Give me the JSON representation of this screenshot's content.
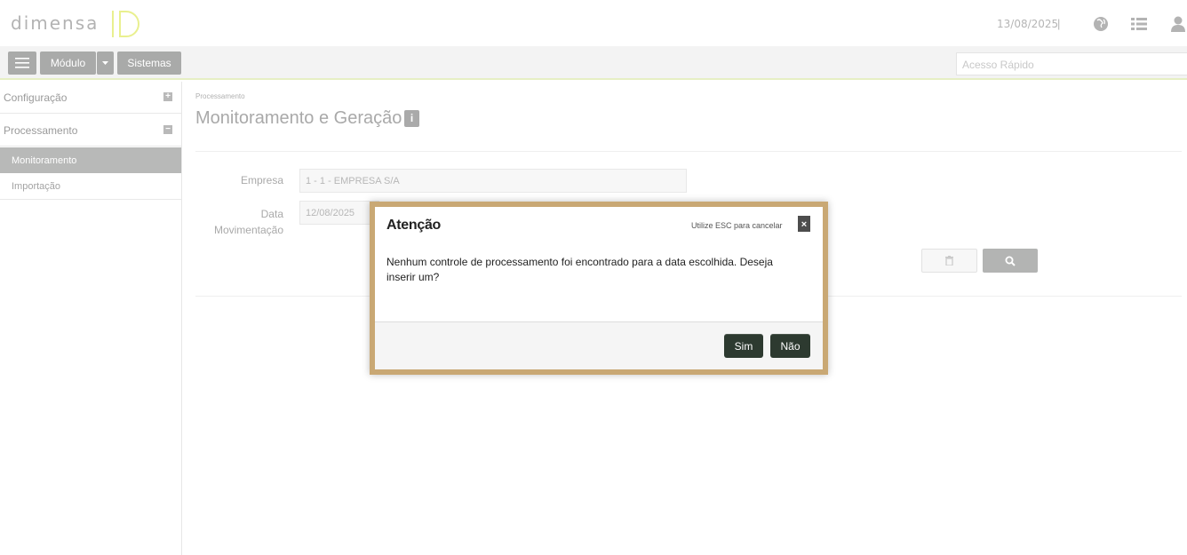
{
  "header": {
    "logo_text": "DIMENSA",
    "date": "13/08/2025",
    "separator": "|",
    "icons": [
      "globe-icon",
      "list-icon",
      "user-icon"
    ]
  },
  "toolbar": {
    "menu_icon": "hamburger-icon",
    "module_label": "Módulo",
    "systems_label": "Sistemas",
    "quick_access_placeholder": "Acesso Rápido"
  },
  "sidebar": {
    "items": [
      {
        "label": "Configuração",
        "toggle": "+"
      },
      {
        "label": "Processamento",
        "toggle": "−"
      }
    ],
    "subitems": [
      {
        "label": "Monitoramento",
        "active": true
      },
      {
        "label": "Importação",
        "active": false
      }
    ]
  },
  "main": {
    "breadcrumb": "Processamento",
    "title": "Monitoramento e Geração",
    "info_icon": "i",
    "form": {
      "empresa_label": "Empresa",
      "empresa_value": "1 - 1 - EMPRESA S/A",
      "data_label_line1": "Data",
      "data_label_line2": "Movimentação",
      "data_value": "12/08/2025"
    }
  },
  "dialog": {
    "title": "Atenção",
    "hint": "Utilize ESC para cancelar",
    "close": "×",
    "message": "Nenhum controle de processamento foi encontrado para a data escolhida. Deseja inserir um?",
    "yes_label": "Sim",
    "no_label": "Não",
    "border_color": "#c9a874",
    "button_color": "#2d3a30"
  }
}
